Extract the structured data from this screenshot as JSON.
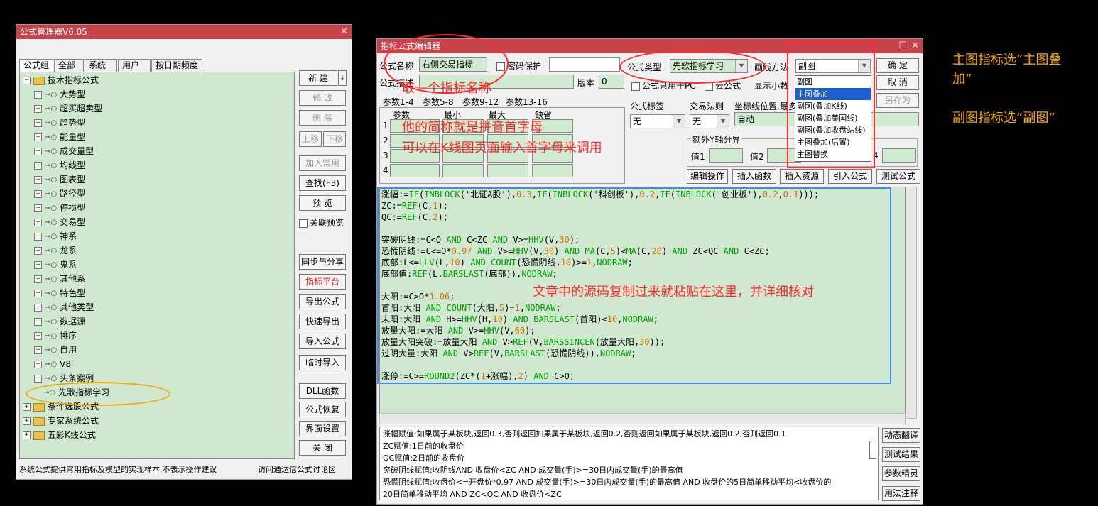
{
  "manager": {
    "title": "公式管理器V6.05",
    "tabs": [
      "公式组",
      "全部",
      "系统",
      "用户",
      "按日期频度"
    ],
    "tree": {
      "root": "技术指标公式",
      "children": [
        "大势型",
        "超买超卖型",
        "趋势型",
        "能量型",
        "成交量型",
        "均线型",
        "图表型",
        "路径型",
        "停损型",
        "交易型",
        "神系",
        "龙系",
        "鬼系",
        "其他系",
        "特色型",
        "其他类型",
        "数据源",
        "排序",
        "自用",
        "V8",
        "头条案例",
        "先歌指标学习"
      ],
      "others": [
        "条件选股公式",
        "专家系统公式",
        "五彩K线公式"
      ]
    },
    "buttons": {
      "new": "新 建",
      "new_arrow": "↓",
      "modify": "修 改",
      "delete": "删 除",
      "up": "上移",
      "down": "下移",
      "add_common": "加入常用",
      "find": "查找(F3)",
      "preview": "预 览",
      "link_preview": "关联预览",
      "sync": "同步与分享",
      "platform": "指标平台",
      "export": "导出公式",
      "quick_export": "快速导出",
      "import": "导入公式",
      "temp_import": "临时导入",
      "dll": "DLL函数",
      "restore": "公式恢复",
      "ui_settings": "界面设置",
      "close": "关 闭"
    },
    "status_left": "系统公式提供常用指标及模型的实现样本,不表示操作建议",
    "status_right": "访问通达信公式讨论区"
  },
  "editor": {
    "title": "指标公式编辑器",
    "name_label": "公式名称",
    "name_value": "右侧交易指标",
    "password_label": "密码保护",
    "desc_label": "公式描述",
    "version_label": "版本",
    "version_value": "0",
    "type_label": "公式类型",
    "type_value": "先歌指标学习",
    "draw_label": "画线方法",
    "draw_value": "副图",
    "pc_only": "公式只用于PC",
    "cloud": "云公式",
    "show_decimal": "显示小数",
    "param_tabs": [
      "参数1-4",
      "参数5-8",
      "参数9-12",
      "参数13-16"
    ],
    "param_headers": [
      "参数",
      "最小",
      "最大",
      "缺省"
    ],
    "param_rows": [
      "1",
      "2",
      "3",
      "4"
    ],
    "label_tag": "公式标签",
    "label_tag_value": "无",
    "trade_rule": "交易法则",
    "trade_rule_value": "无",
    "axis_label": "坐标线位置,最多",
    "axis_value": "自动",
    "extra_y": "额外Y轴分界",
    "y1": "值1",
    "y2": "值2",
    "y4": "4",
    "buttons": {
      "ok": "确 定",
      "cancel": "取 消",
      "save_as": "另存为",
      "edit_op": "编辑操作",
      "insert_fn": "插入函数",
      "insert_res": "插入资源",
      "import_formula": "引入公式",
      "test_formula": "测试公式",
      "dyn_translate": "动态翻译",
      "test_result": "测试结果",
      "param_wizard": "参数精灵",
      "usage_note": "用法注释"
    },
    "draw_options": [
      "副图",
      "主图叠加",
      "副图(叠加K线)",
      "副图(叠加美国线)",
      "副图(叠加收盘站线)",
      "主图叠加(后置)",
      "主图替换"
    ],
    "explanations": [
      "涨幅赋值:如果属于某板块,返回0.3,否则返回如果属于某板块,返回0.2,否则返回如果属于某板块,返回0.2,否则返回0.1",
      "ZC赋值:1日前的收盘价",
      "QC赋值:2日前的收盘价",
      "突破阴线赋值:收阴线AND 收盘价<ZC AND 成交量(手)>=30日内成交量(手)的最高值",
      "恐慌阴线赋值:收盘价<=开盘价*0.97 AND 成交量(手)>=30日内成交量(手)的最高值 AND 收盘价的5日简单移动平均<收盘价的",
      "20日简单移动平均 AND ZC<QC AND 收盘价<ZC"
    ]
  },
  "annotations": {
    "name_tip": "取一个指标名称",
    "abbr_tip1": "他的简称就是拼音首字母",
    "abbr_tip2": "可以在K线图页面输入首字母来调用",
    "paste_tip": "文章中的源码复制过来就粘贴在这里，并详细核对",
    "main_tip1": "主图指标选“主图叠",
    "main_tip2": "加”",
    "sub_tip": "副图指标选“副图”"
  },
  "colors": {
    "titlebar": "#c8424a",
    "code_bg": "#cfe8cf",
    "annotation_red": "#ff2a2a",
    "annotation_yellow": "#f5a800",
    "highlight": "#1e5fd0"
  }
}
